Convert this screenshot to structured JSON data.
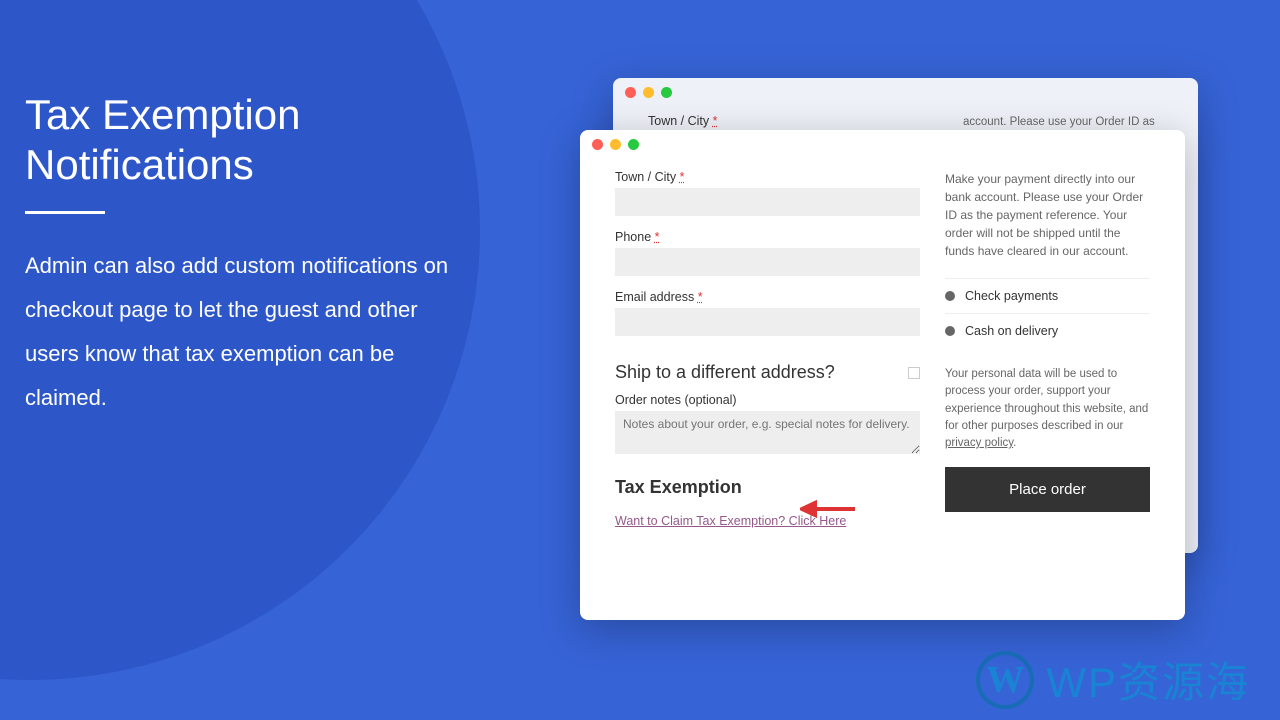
{
  "hero": {
    "title_line1": "Tax Exemption",
    "title_line2": "Notifications",
    "description": "Admin can also add custom notifications on checkout page to let the guest and other users know that tax exemption can be claimed."
  },
  "back_window": {
    "town_label": "Town / City ",
    "payment_notice_partial": "account. Please use your Order ID as the"
  },
  "checkout": {
    "town_label": "Town / City ",
    "phone_label": "Phone ",
    "email_label": "Email address ",
    "ship_heading": "Ship to a different address?",
    "order_notes_label": "Order notes (optional)",
    "order_notes_placeholder": "Notes about your order, e.g. special notes for delivery.",
    "tax_heading": "Tax Exemption",
    "tax_link": "Want to Claim Tax Exemption? Click Here"
  },
  "payment": {
    "notice": "Make your payment directly into our bank account. Please use your Order ID as the payment reference. Your order will not be shipped until the funds have cleared in our account.",
    "check_label": "Check payments",
    "cod_label": "Cash on delivery",
    "privacy_text": "Your personal data will be used to process your order, support your experience throughout this website, and for other purposes described in our ",
    "privacy_link": "privacy policy",
    "place_order": "Place order"
  },
  "watermark": {
    "text": "WP资源海"
  }
}
